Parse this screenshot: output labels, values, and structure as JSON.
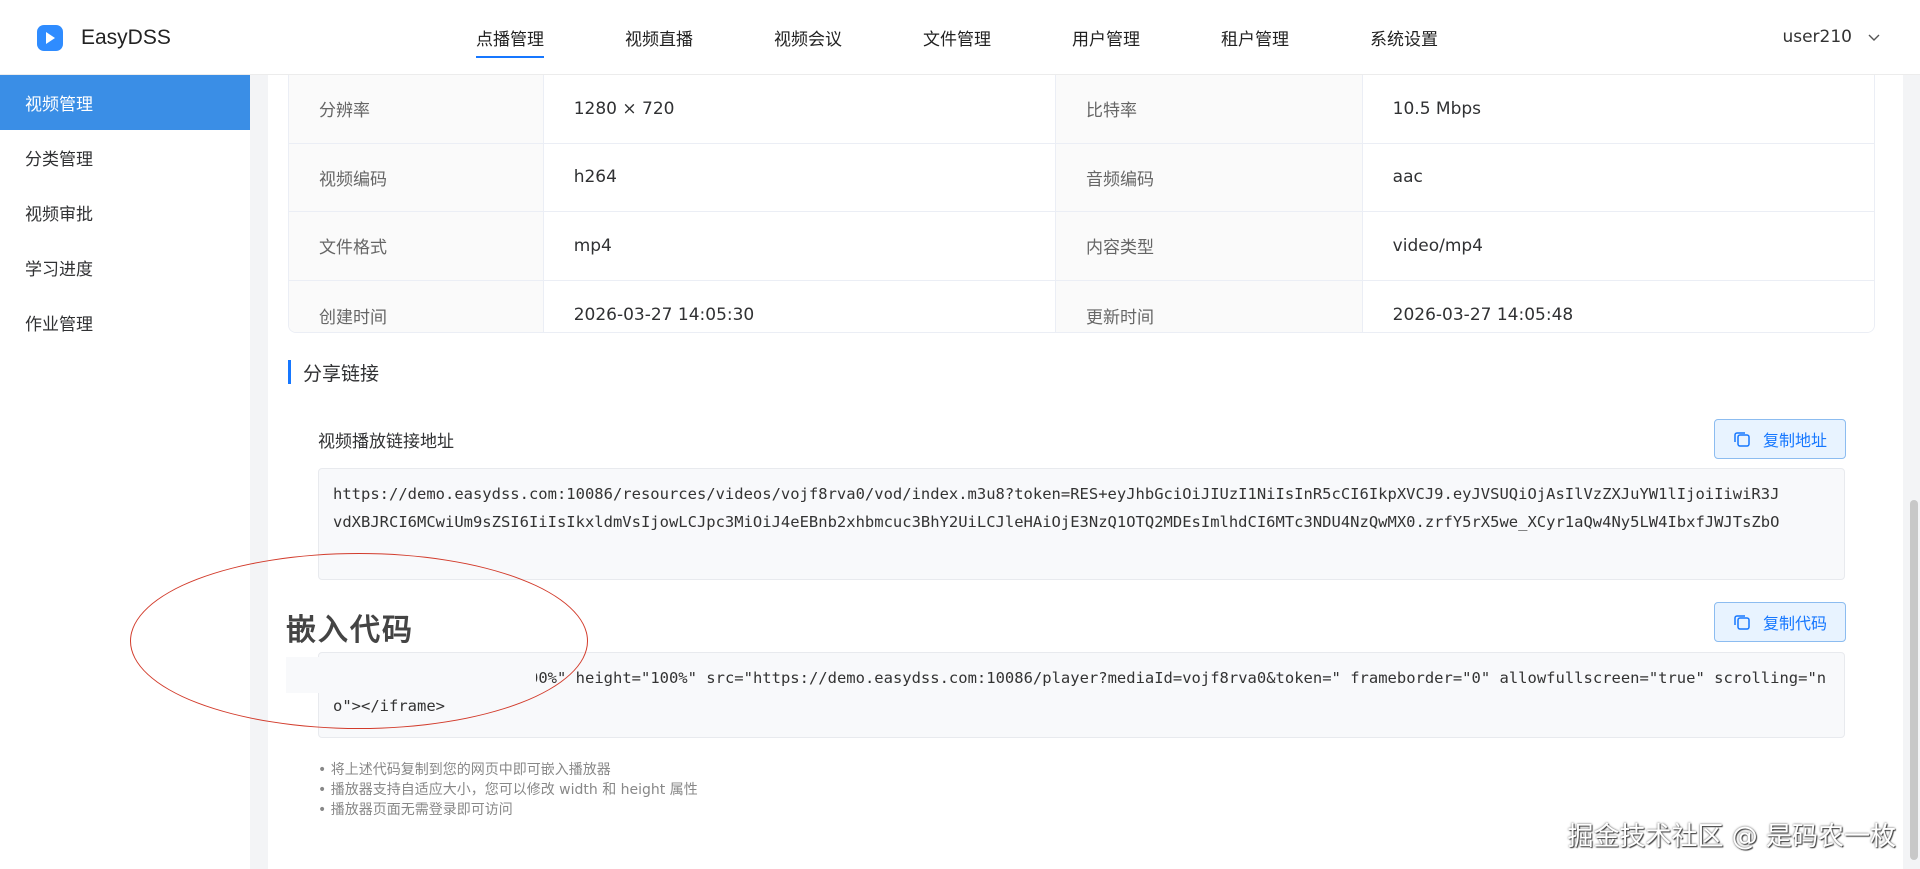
{
  "app": {
    "name": "EasyDSS"
  },
  "nav": {
    "items": [
      "点播管理",
      "视频直播",
      "视频会议",
      "文件管理",
      "用户管理",
      "租户管理",
      "系统设置"
    ],
    "active": "点播管理"
  },
  "user": {
    "name": "user210"
  },
  "sidebar": {
    "items": [
      {
        "label": "视频管理",
        "active": true
      },
      {
        "label": "分类管理",
        "active": false
      },
      {
        "label": "视频审批",
        "active": false
      },
      {
        "label": "学习进度",
        "active": false
      },
      {
        "label": "作业管理",
        "active": false
      }
    ]
  },
  "info": {
    "rows": [
      {
        "k1": "分辨率",
        "v1": "1280 × 720",
        "k2": "比特率",
        "v2": "10.5 Mbps"
      },
      {
        "k1": "视频编码",
        "v1": "h264",
        "k2": "音频编码",
        "v2": "aac"
      },
      {
        "k1": "文件格式",
        "v1": "mp4",
        "k2": "内容类型",
        "v2": "video/mp4"
      },
      {
        "k1": "创建时间",
        "v1": "2026-03-27 14:05:30",
        "k2": "更新时间",
        "v2": "2026-03-27 14:05:48"
      }
    ]
  },
  "share": {
    "section_title": "分享链接",
    "url_label": "视频播放链接地址",
    "copy_url_label": "复制地址",
    "url_line1": "https://demo.easydss.com:10086/resources/videos/vojf8rva0/vod/index.m3u8?token=RES+eyJhbGciOiJIUzI1NiIsInR5cCI6IkpXVCJ9.eyJVSUQiOjAsIlVzZXJuYW1lIjoiIiwiR3J",
    "url_line2": "vdXBJRCI6MCwiUm9sZSI6IiIsIkxldmVsIjowLCJpc3MiOiJ4eEBnb2xhbmcuc3BhY2UiLCJleHAiOjE3NzQ1OTQ2MDEsImlhdCI6MTc3NDU4NzQwMX0.zrfY5rX5we_XCyr1aQw4Ny5LW4IbxfJWJTsZbO",
    "embed_title": "嵌入代码",
    "copy_code_label": "复制代码",
    "embed_line1": "00%\" height=\"100%\" src=\"https://demo.easydss.com:10086/player?mediaId=vojf8rva0&token=\" frameborder=\"0\" allowfullscreen=\"true\" scrolling=\"n",
    "embed_line2": "o\"></iframe>",
    "tips": [
      "• 将上述代码复制到您的网页中即可嵌入播放器",
      "• 播放器支持自适应大小，您可以修改 width 和 height 属性",
      "• 播放器页面无需登录即可访问"
    ]
  },
  "watermark": "掘金技术社区 @ 是码农一枚"
}
